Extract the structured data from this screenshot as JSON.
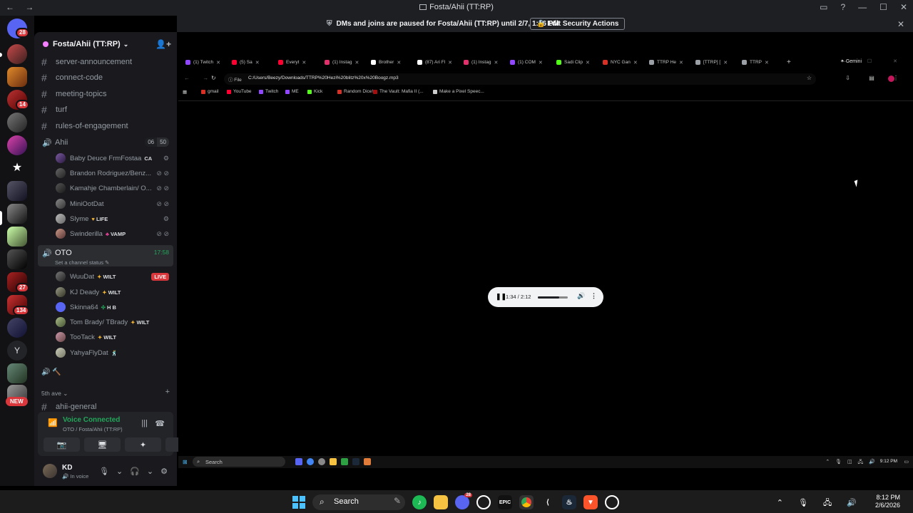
{
  "window": {
    "title": "Fosta/Ahii (TT:RP)",
    "nav": "← →",
    "controls": [
      "▭",
      "?",
      "—",
      "☐",
      "✕"
    ]
  },
  "rail": {
    "badges": [
      "28",
      "14",
      "27",
      "134"
    ],
    "letter": "Y",
    "new_label": "NEW"
  },
  "notice": {
    "text": "DMs and joins are paused for Fosta/Ahii (TT:RP) until 2/7, 1:16 PM",
    "button": "Edit Security Actions",
    "close": "✕"
  },
  "server": {
    "name": "Fosta/Ahii (TT:RP)",
    "chevron": "⌄",
    "invite_icon": "👤+"
  },
  "channels": [
    "server-announcement",
    "connect-code",
    "meeting-topics",
    "turf",
    "rules-of-engagement"
  ],
  "voice1": {
    "name": "Ahii",
    "count_a": "06",
    "count_b": "50",
    "members": [
      {
        "name": "Baby Deuce FrmFostaa",
        "tag": "CA",
        "icons": "⚙"
      },
      {
        "name": "Brandon Rodriguez/Benz...",
        "tag": "",
        "icons": "⊘ ⊘"
      },
      {
        "name": "Kamahje Chamberlain/ O...",
        "tag": "",
        "icons": "⊘ ⊘"
      },
      {
        "name": "MiniOotDat",
        "tag": "",
        "icons": "⊘ ⊘"
      },
      {
        "name": "Slyme",
        "tag": "LIFE",
        "icons": "⚙"
      },
      {
        "name": "Swinderilla",
        "tag": "VAMP",
        "icons": "⊘ ⊘"
      }
    ]
  },
  "voice2": {
    "name": "OTO",
    "timer": "17:58",
    "status": "Set a channel status ✎",
    "live": "LIVE",
    "members": [
      {
        "name": "WuuDat",
        "tag": "WILT"
      },
      {
        "name": "KJ Deady",
        "tag": "WILT"
      },
      {
        "name": "Skinna64",
        "tag": "H B"
      },
      {
        "name": "Tom Brady/ TBrady",
        "tag": "WILT"
      },
      {
        "name": "TooTack",
        "tag": "WILT"
      },
      {
        "name": "YahyaFlyDat",
        "tag": "🕺"
      }
    ]
  },
  "extra_row_icons": "🔊 🔨",
  "category": {
    "name": "5th ave ⌄",
    "plus": "+"
  },
  "last_channel": "ahii-general",
  "voice_panel": {
    "status": "Voice Connected",
    "location": "OTO / Fosta/Ahii (TT:RP)",
    "buttons": [
      "📷",
      "🖥",
      "✦",
      "🔊"
    ]
  },
  "user": {
    "name": "KD",
    "status": "In voice",
    "controls": [
      "🎙",
      "⌄",
      "🎧",
      "⌄",
      "⚙"
    ]
  },
  "browser": {
    "tabs": [
      {
        "label": "(1) Twitch",
        "color": "#9146ff"
      },
      {
        "label": "(5) Sa",
        "color": "#ff0033"
      },
      {
        "label": "Everyt",
        "color": "#ff0033"
      },
      {
        "label": "(1) Instag",
        "color": "#e1306c"
      },
      {
        "label": "Brother",
        "color": "#ffffff"
      },
      {
        "label": "(87) Ari Fl",
        "color": "#ffffff"
      },
      {
        "label": "(1) Instag",
        "color": "#e1306c"
      },
      {
        "label": "(1) COM",
        "color": "#9146ff"
      },
      {
        "label": "Sadi Clip",
        "color": "#53fc18"
      },
      {
        "label": "NYC Gan",
        "color": "#d93025"
      },
      {
        "label": "TTRP He",
        "color": "#9aa0a6"
      },
      {
        "label": "[TTRP] [",
        "color": "#9aa0a6"
      },
      {
        "label": "TTRP",
        "color": "#9aa0a6"
      }
    ],
    "gemini": "✦ Gemini",
    "win_controls": "— ☐ ✕",
    "nav": "← →",
    "reload": "↻",
    "file_label": "ⓘ File",
    "url": "C:/Users/Beezy/Downloads/TTRP%20Hezi%20blitz%20x%20Boogz.mp3",
    "star": "☆",
    "tools": "⇩ ▤ ⋮",
    "bookmarks": [
      {
        "label": "gmail",
        "color": "#d93025"
      },
      {
        "label": "YouTube",
        "color": "#ff0033"
      },
      {
        "label": "Twitch",
        "color": "#9146ff"
      },
      {
        "label": "ME",
        "color": "#9146ff"
      },
      {
        "label": "Kick",
        "color": "#53fc18"
      },
      {
        "label": "Random Dice!",
        "color": "#d93025"
      },
      {
        "label": "The Vault: Mafia II (...",
        "color": "#a50e0e"
      },
      {
        "label": "Make a Pixel Speec...",
        "color": "#cccccc"
      }
    ],
    "apps_icon": "▦"
  },
  "player": {
    "time": "1:34 / 2:12",
    "progress": 0.71,
    "pause": "❚❚",
    "volume": "🔊",
    "more": "⋮"
  },
  "inner_taskbar": {
    "search": "Search",
    "tray": "⌃ 🎙 ◫ 🖧 🔊",
    "clock": "9:12 PM",
    "notif": "▭"
  },
  "taskbar": {
    "search": "Search",
    "tray": "⌃ 🎙 🖧 🔊",
    "time": "8:12 PM",
    "date": "2/6/2026"
  }
}
